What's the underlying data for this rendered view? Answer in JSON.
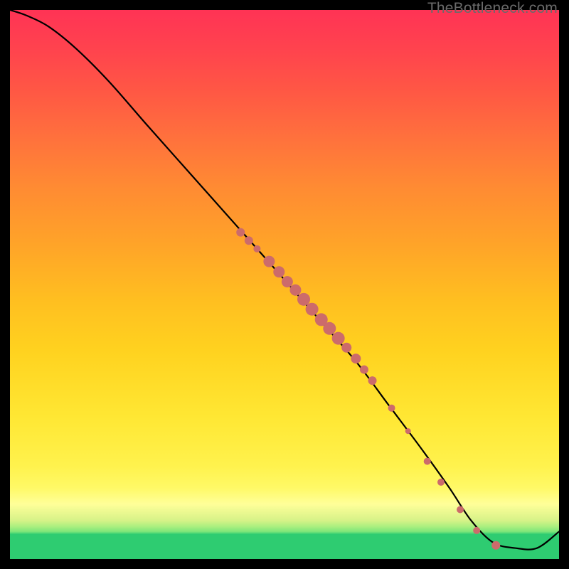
{
  "watermark": "TheBottleneck.com",
  "chart_data": {
    "type": "line",
    "title": "",
    "xlabel": "",
    "ylabel": "",
    "xlim": [
      0,
      100
    ],
    "ylim": [
      0,
      100
    ],
    "grid": false,
    "note": "X and Y are normalized 0–100 (percent of plot width/height). Y is bottleneck % (100 at top-left, dropping toward 0 at the flat region near right, then rising).",
    "series": [
      {
        "name": "bottleneck-curve",
        "x": [
          0,
          3,
          7,
          12,
          18,
          25,
          33,
          41,
          49,
          56,
          63,
          69,
          75,
          80,
          84,
          88,
          92,
          96,
          100
        ],
        "y": [
          100,
          99,
          97,
          93,
          87,
          79,
          70,
          61,
          52,
          44,
          36,
          28,
          20,
          13,
          7,
          3,
          2,
          2,
          5
        ]
      }
    ],
    "scatter_points": {
      "name": "sample-points",
      "color": "#cc6b6b",
      "points": [
        {
          "x": 42.0,
          "y": 59.5,
          "r": 6
        },
        {
          "x": 43.5,
          "y": 58.0,
          "r": 6
        },
        {
          "x": 45.0,
          "y": 56.5,
          "r": 5
        },
        {
          "x": 47.2,
          "y": 54.2,
          "r": 8
        },
        {
          "x": 49.0,
          "y": 52.3,
          "r": 8
        },
        {
          "x": 50.5,
          "y": 50.5,
          "r": 8
        },
        {
          "x": 52.0,
          "y": 49.0,
          "r": 8
        },
        {
          "x": 53.5,
          "y": 47.3,
          "r": 9
        },
        {
          "x": 55.0,
          "y": 45.5,
          "r": 9
        },
        {
          "x": 56.7,
          "y": 43.6,
          "r": 9
        },
        {
          "x": 58.2,
          "y": 42.0,
          "r": 9
        },
        {
          "x": 59.8,
          "y": 40.2,
          "r": 9
        },
        {
          "x": 61.3,
          "y": 38.5,
          "r": 7
        },
        {
          "x": 63.0,
          "y": 36.5,
          "r": 7
        },
        {
          "x": 64.5,
          "y": 34.5,
          "r": 6
        },
        {
          "x": 66.0,
          "y": 32.5,
          "r": 6
        },
        {
          "x": 69.5,
          "y": 27.5,
          "r": 5
        },
        {
          "x": 72.5,
          "y": 23.3,
          "r": 4
        },
        {
          "x": 76.0,
          "y": 17.8,
          "r": 5
        },
        {
          "x": 78.5,
          "y": 14.0,
          "r": 5
        },
        {
          "x": 82.0,
          "y": 9.0,
          "r": 5
        },
        {
          "x": 85.0,
          "y": 5.2,
          "r": 5
        },
        {
          "x": 88.5,
          "y": 2.5,
          "r": 6
        }
      ]
    },
    "gradient_stops": [
      {
        "pct": 0,
        "color": "#2ecc71"
      },
      {
        "pct": 5,
        "color": "#7ee67a"
      },
      {
        "pct": 10,
        "color": "#ffff99"
      },
      {
        "pct": 25,
        "color": "#ffe733"
      },
      {
        "pct": 50,
        "color": "#ffae25"
      },
      {
        "pct": 75,
        "color": "#ff7a38"
      },
      {
        "pct": 100,
        "color": "#ff3355"
      }
    ]
  }
}
